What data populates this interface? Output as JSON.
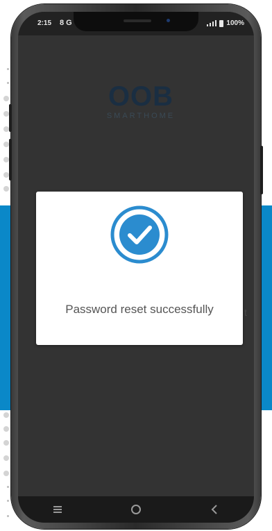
{
  "status_bar": {
    "time": "2:15",
    "left_icons": [
      "notification-icon",
      "sync-icon"
    ],
    "battery_percent": "100%"
  },
  "app": {
    "logo_main": "OOB",
    "logo_sub": "SMARTHOME",
    "background_fragment": "t"
  },
  "dialog": {
    "icon": "check-circle-icon",
    "message": "Password reset successfully"
  },
  "nav_bar": {
    "recents_icon": "recents-icon",
    "home_icon": "home-icon",
    "back_icon": "back-icon"
  },
  "colors": {
    "accent": "#2b8ccf",
    "screen": "#333333",
    "background_band": "#0a88c8",
    "dialog_background": "#ffffff",
    "message_text": "#555555"
  }
}
